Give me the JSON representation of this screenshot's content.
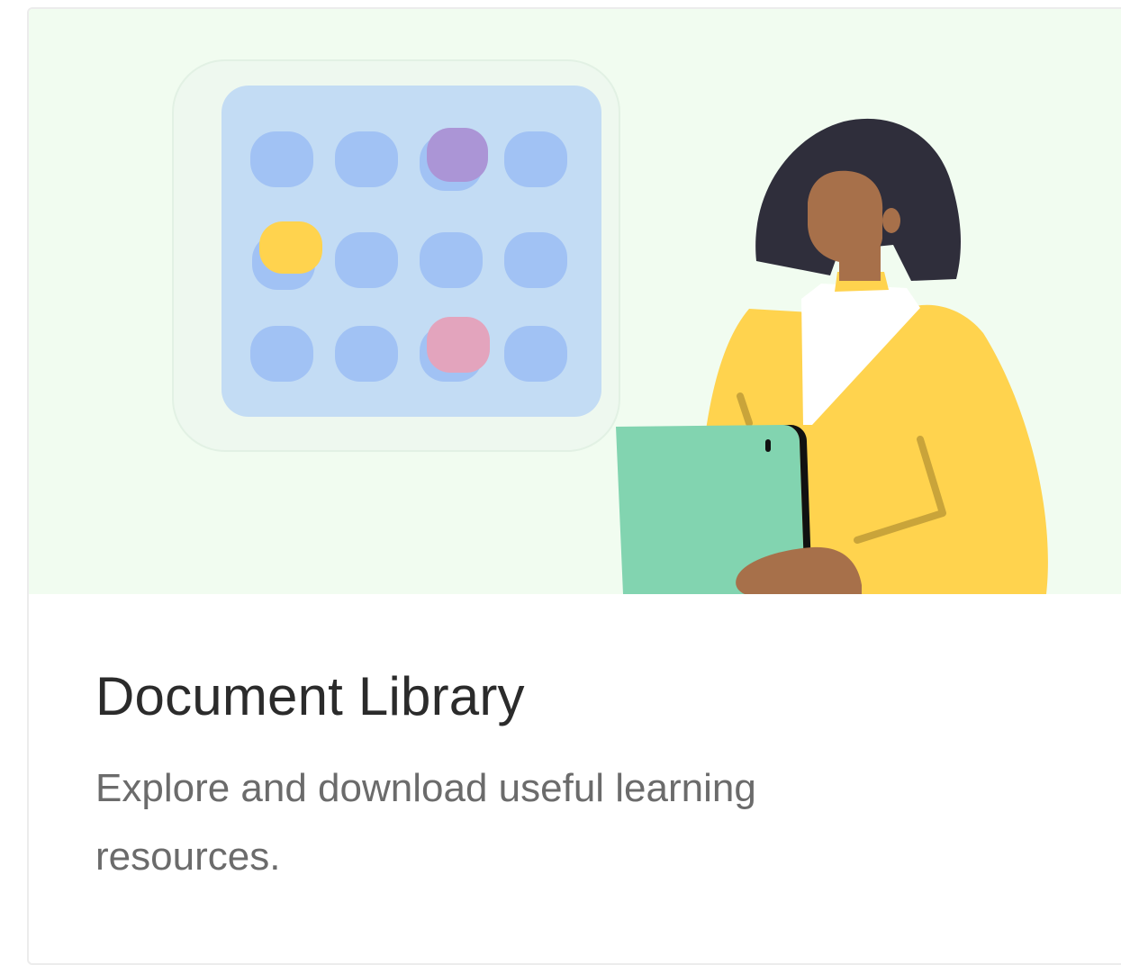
{
  "card": {
    "title": "Document Library",
    "description": "Explore and download useful learning resources.",
    "illustration": {
      "icon": "calendar-grid-with-person-holding-tablet",
      "colors": {
        "background": "#f1fcf0",
        "calendar_outer": "#eef8ef",
        "calendar_inner": "#c3dcf4",
        "calendar_cell": "#a1c2f4",
        "cell_highlight_purple": "#ab95d6",
        "cell_highlight_yellow": "#ffd34e",
        "cell_highlight_pink": "#e3a4bd",
        "hair": "#2f2e3b",
        "skin": "#a7704a",
        "jacket": "#ffd34e",
        "shirt": "#ffffff",
        "tablet": "#82d4b0"
      }
    }
  }
}
